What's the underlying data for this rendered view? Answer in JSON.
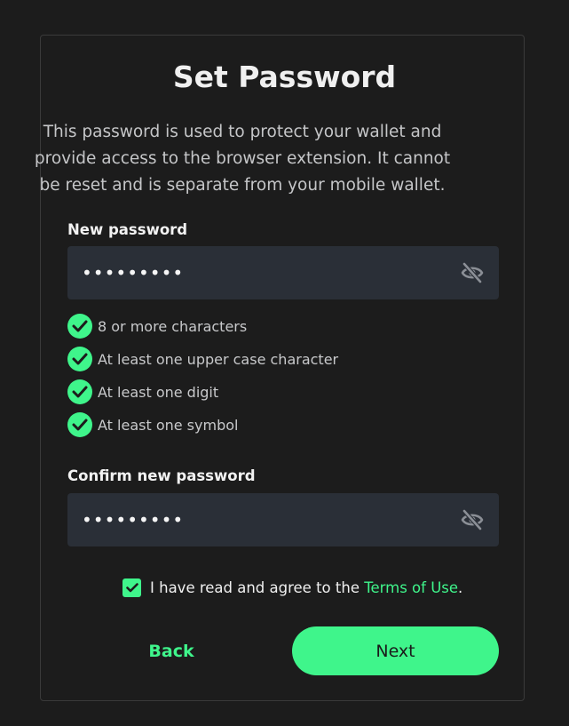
{
  "title": "Set Password",
  "description": "This password is used to protect your wallet and provide access to the browser extension. It cannot be reset and is separate from your mobile wallet.",
  "new_password": {
    "label": "New password",
    "value": "•••••••••",
    "toggle_icon": "eye-off-icon"
  },
  "requirements": [
    {
      "label": "8 or more characters",
      "met": true
    },
    {
      "label": "At least one upper case character",
      "met": true
    },
    {
      "label": "At least one digit",
      "met": true
    },
    {
      "label": "At least one symbol",
      "met": true
    }
  ],
  "confirm_password": {
    "label": "Confirm new password",
    "value": "•••••••••",
    "toggle_icon": "eye-off-icon"
  },
  "agreement": {
    "checked": true,
    "text": "I have read and agree to the ",
    "link": "Terms of Use",
    "suffix": "."
  },
  "buttons": {
    "back": "Back",
    "next": "Next"
  },
  "colors": {
    "background": "#1c1c1c",
    "accent": "#3ff58b",
    "field": "#2a2f37",
    "text": "#f0f0f0",
    "muted_text": "#c5c6c8"
  }
}
